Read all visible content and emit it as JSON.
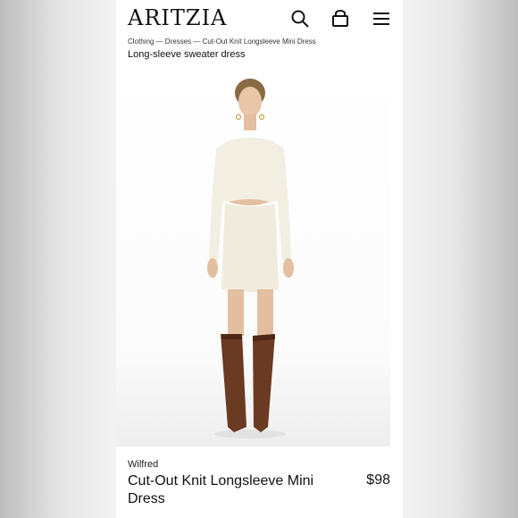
{
  "header": {
    "logo": "ARITZIA",
    "icons": [
      "search-icon",
      "bag-icon",
      "menu-icon"
    ]
  },
  "breadcrumb": [
    "Clothing — ",
    "Dresses — ",
    "Cut-Out Knit Longsleeve Mini Dress"
  ],
  "subtitle": "Long-sleeve sweater dress",
  "product": {
    "brand": "Wilfred",
    "name": "Cut-Out Knit Longsleeve Mini Dress",
    "price": "$98"
  },
  "colors": {
    "dress": "#f3eee2",
    "boots": "#6b3a22",
    "text": "#111111"
  }
}
